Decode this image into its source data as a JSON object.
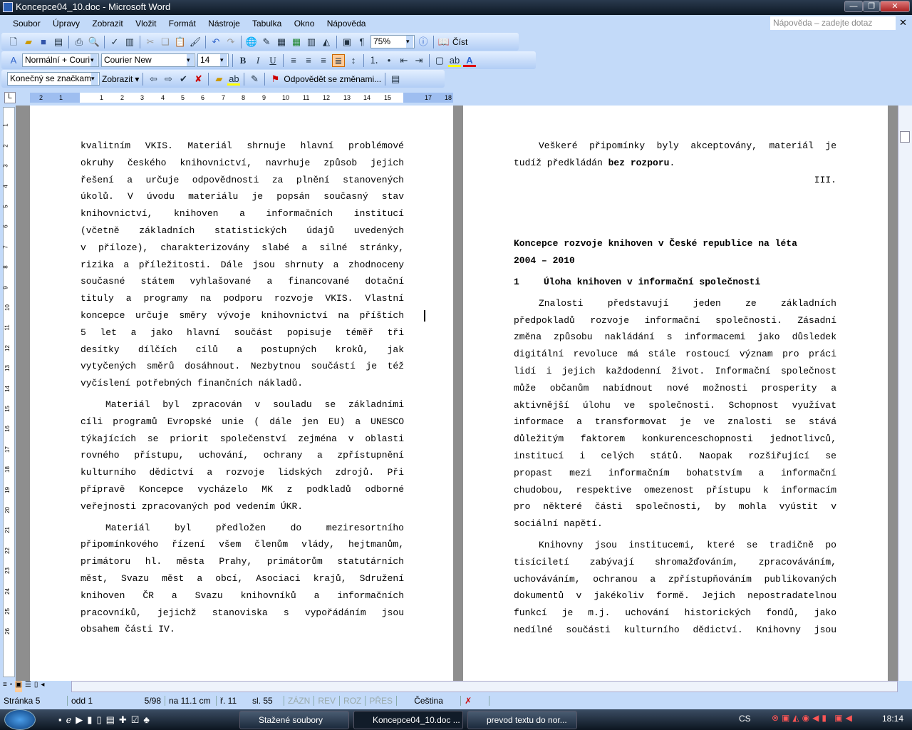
{
  "window": {
    "title": "Koncepce04_10.doc - Microsoft Word"
  },
  "menu": [
    "Soubor",
    "Úpravy",
    "Zobrazit",
    "Vložit",
    "Formát",
    "Nástroje",
    "Tabulka",
    "Okno",
    "Nápověda"
  ],
  "help": {
    "placeholder": "Nápověda – zadejte dotaz"
  },
  "toolbar1": {
    "zoom": "75%",
    "read": "Číst"
  },
  "toolbar2": {
    "style": "Normální + Couri",
    "font": "Courier New",
    "size": "14",
    "bold": "B",
    "italic": "I",
    "underline": "U"
  },
  "toolbar3": {
    "markup": "Konečný se značkami",
    "show": "Zobrazit",
    "reply": "Odpovědět se změnami..."
  },
  "ruler": {
    "ticks": [
      "2",
      "1",
      "1",
      "2",
      "3",
      "4",
      "5",
      "6",
      "7",
      "8",
      "9",
      "10",
      "11",
      "12",
      "13",
      "14",
      "15",
      "17",
      "18"
    ]
  },
  "left_page": {
    "paragraphs": [
      {
        "indent": false,
        "lines": [
          "kvalitním VKIS. Materiál shrnuje hlavní problémové",
          "okruhy českého knihovnictví, navrhuje způsob jejich",
          "řešení a určuje odpovědnosti za plnění stanovených",
          "úkolů. V úvodu materiálu je popsán současný stav",
          "knihovnictví, knihoven a informačních institucí",
          "(včetně základních statistických údajů uvedených",
          "v příloze), charakterizovány slabé a silné stránky,",
          "rizika a příležitosti. Dále jsou shrnuty a zhodnoceny",
          "současné státem vyhlašované a financované dotační",
          "tituly a programy na podporu rozvoje VKIS. Vlastní",
          "koncepce určuje směry vývoje knihovnictví na příštích",
          "5 let a jako hlavní součást popisuje téměř tři",
          "desítky dílčích cílů a postupných kroků, jak",
          "vytyčených směrů dosáhnout. Nezbytnou součástí je též",
          "vyčíslení potřebných finančních nákladů."
        ]
      },
      {
        "indent": true,
        "lines": [
          "Materiál byl zpracován v souladu se základními",
          "cíli programů Evropské unie ( dále jen EU) a UNESCO",
          "týkajících se priorit společenství zejména v oblasti",
          "rovného přístupu, uchování, ochrany a zpřístupnění",
          "kulturního dědictví a rozvoje lidských zdrojů. Při",
          "přípravě Koncepce vycházelo MK z podkladů odborné",
          "veřejnosti zpracovaných pod vedením ÚKR."
        ]
      },
      {
        "indent": true,
        "lines": [
          "Materiál byl předložen do meziresortního",
          "připomínkového řízení všem členům vlády, hejtmanům,",
          "primátoru hl. města Prahy, primátorům statutárních",
          "měst, Svazu měst a obcí, Asociaci krajů, Sdružení",
          "knihoven ČR a Svazu knihovníků a informačních",
          "pracovníků, jejichž stanoviska s vypořádáním jsou",
          "obsahem části IV."
        ]
      }
    ]
  },
  "right_page": {
    "intro": [
      "Veškeré připomínky byly akceptovány, materiál je",
      "tudíž předkládán "
    ],
    "intro_bold": "bez rozporu",
    "intro_end": ".",
    "section": "III.",
    "heading": [
      "Koncepce rozvoje knihoven v České republice na léta",
      "2004 – 2010"
    ],
    "subheading_num": "1",
    "subheading": "Úloha knihoven v informační společnosti",
    "paragraphs": [
      {
        "indent": true,
        "lines": [
          "Znalosti představují jeden ze základních",
          "předpokladů rozvoje informační společnosti. Zásadní",
          "změna způsobu nakládání s informacemi jako důsledek",
          "digitální revoluce má stále rostoucí význam pro práci",
          "lidí i jejich každodenní život. Informační společnost",
          "může občanům nabídnout nové možnosti prosperity a",
          "aktivnější úlohu ve společnosti. Schopnost využívat",
          "informace a transformovat je ve znalosti se stává",
          "důležitým faktorem konkurenceschopnosti jednotlivců,",
          "institucí i celých států. Naopak rozšiřující se",
          "propast mezi informačním bohatstvím a informační",
          "chudobou, respektive omezenost přístupu k informacím",
          "pro některé části společnosti, by mohla vyústit v",
          "sociální napětí."
        ]
      },
      {
        "indent": true,
        "lines": [
          "Knihovny jsou institucemi, které se tradičně po",
          "tisíciletí zabývají shromažďováním, zpracováváním,",
          "uchováváním, ochranou a zpřístupňováním publikovaných",
          "dokumentů v jakékoliv formě. Jejich nepostradatelnou",
          "funkcí je m.j. uchování historických fondů, jako",
          "nedílné součásti kulturního dědictví. Knihovny jsou"
        ],
        "continues": true
      }
    ]
  },
  "status": {
    "page": "Stránka 5",
    "section": "odd 1",
    "pages": "5/98",
    "at": "na 11.1 cm",
    "line": "ř. 11",
    "col": "sl. 55",
    "rec": "ZÁZN",
    "trk": "REV",
    "ext": "ROZ",
    "ovr": "PŘES",
    "lang": "Čeština"
  },
  "taskbar": {
    "tasks": [
      "Stažené soubory",
      "Koncepce04_10.doc ...",
      "prevod textu do nor..."
    ],
    "lang": "CS",
    "clock": "18:14"
  }
}
